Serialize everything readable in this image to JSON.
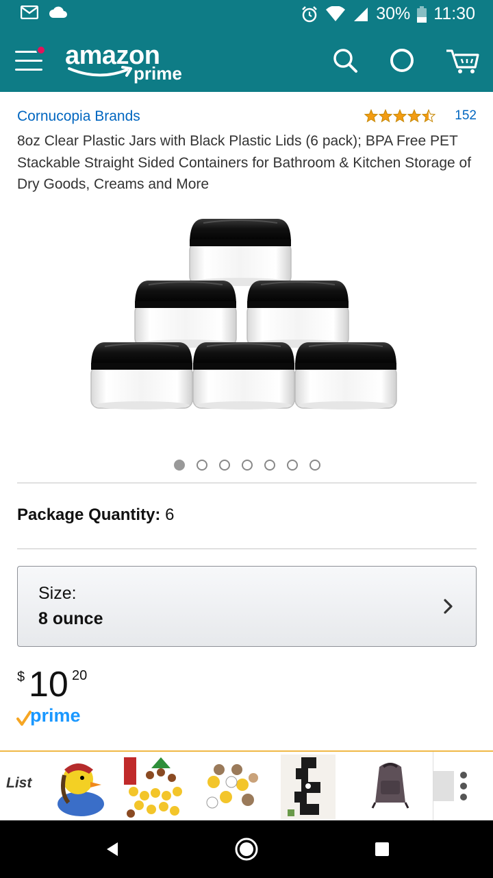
{
  "status_bar": {
    "battery": "30%",
    "time": "11:30"
  },
  "header": {
    "logo_text": "amazon",
    "logo_sub": "prime"
  },
  "product": {
    "brand": "Cornucopia Brands",
    "rating_stars": 4.5,
    "rating_count": "152",
    "title": "8oz Clear Plastic Jars with Black Plastic Lids (6 pack); BPA Free PET Stackable Straight Sided Containers for Bathroom & Kitchen Storage of Dry Goods, Creams and More",
    "image_count": 7,
    "active_image": 1
  },
  "package": {
    "label": "Package Quantity:",
    "value": "6"
  },
  "size": {
    "label": "Size:",
    "value": "8 ounce"
  },
  "price": {
    "currency": "$",
    "whole": "10",
    "fraction": "20"
  },
  "prime_badge": "prime",
  "list_strip": {
    "label": "List"
  },
  "colors": {
    "header_bg": "#0e7c86",
    "link": "#0066c0",
    "star": "#f39c12",
    "notification_dot": "#e3125a",
    "prime_blue": "#1a98ff",
    "prime_check": "#f6a623"
  }
}
